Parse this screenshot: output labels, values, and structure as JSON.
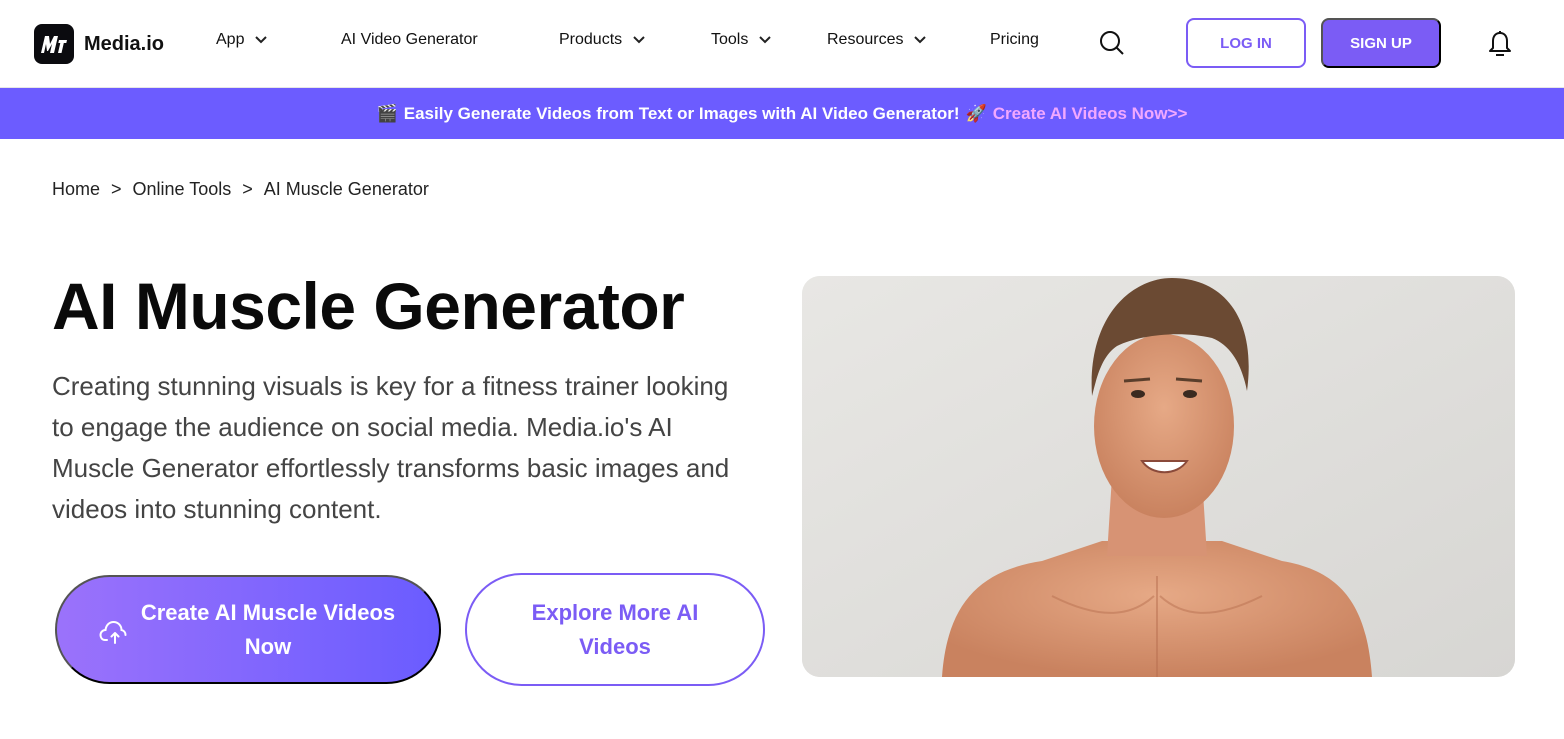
{
  "header": {
    "logo_text": "Media.io",
    "nav": [
      {
        "label": "App",
        "has_dropdown": true
      },
      {
        "label": "AI Video Generator",
        "has_dropdown": false
      },
      {
        "label": "Products",
        "has_dropdown": true
      },
      {
        "label": "Tools",
        "has_dropdown": true
      },
      {
        "label": "Resources",
        "has_dropdown": true
      },
      {
        "label": "Pricing",
        "has_dropdown": false
      }
    ],
    "login_label": "LOG IN",
    "signup_label": "SIGN UP",
    "icons": {
      "search": "search-icon",
      "notifications": "bell-icon",
      "dropdown": "chevron-down-icon"
    }
  },
  "banner": {
    "lead_emoji": "🎬",
    "text": "Easily Generate Videos from Text or Images with AI Video Generator!",
    "rocket_emoji": "🚀",
    "link_text": "Create AI Videos Now>>"
  },
  "breadcrumb": {
    "items": [
      "Home",
      "Online Tools",
      "AI Muscle Generator"
    ],
    "separator": ">"
  },
  "hero": {
    "title": "AI Muscle Generator",
    "description": "Creating stunning visuals is key for a fitness trainer looking to engage the audience on social media. Media.io's AI Muscle Generator effortlessly transforms basic images and videos into stunning content.",
    "primary_button": "Create AI Muscle Videos Now",
    "secondary_button": "Explore More AI Videos",
    "image_alt": "Smiling shirtless muscular man in front of a white textured wall"
  },
  "colors": {
    "brand": "#7b5cf5",
    "banner_bg": "#6c5cff",
    "banner_link": "#f2a8ff",
    "gradient_start": "#9b72fb",
    "gradient_end": "#6a5cff"
  }
}
